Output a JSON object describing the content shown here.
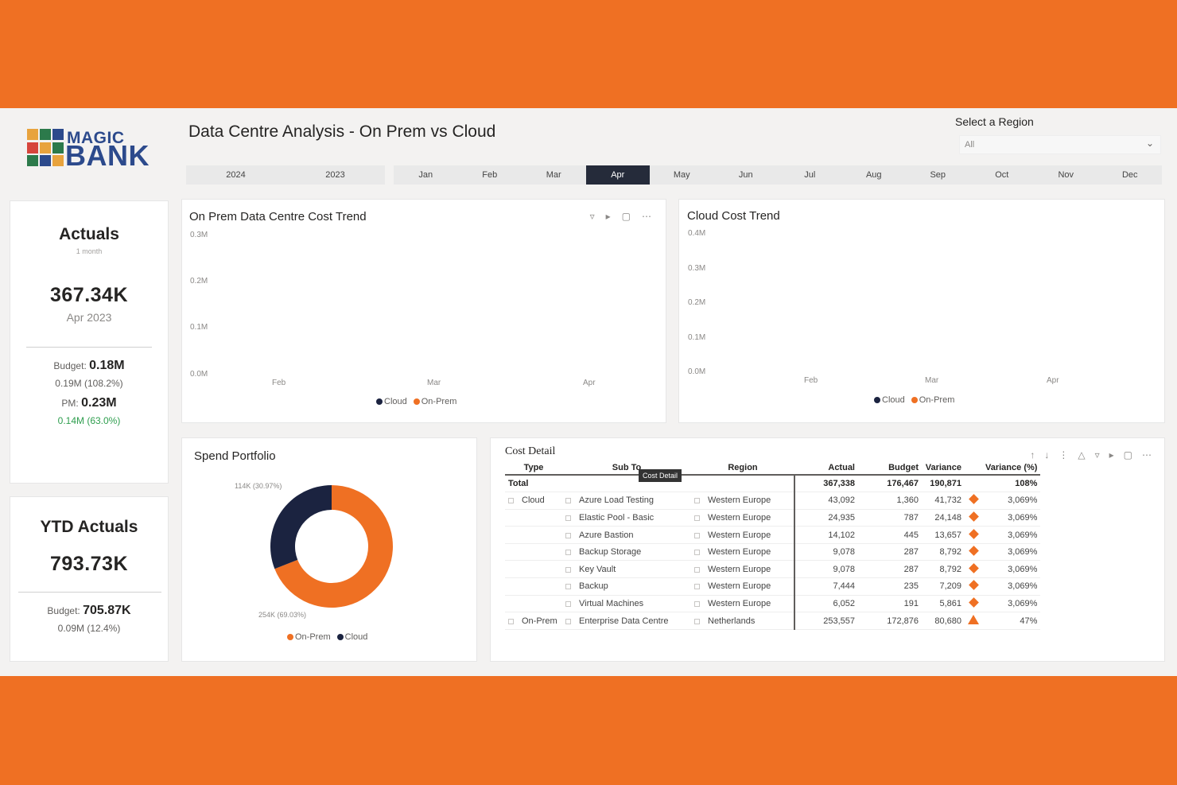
{
  "app": {
    "title": "Data Centre Analysis - On Prem vs Cloud",
    "logo_top": "MAGIC",
    "logo_bottom": "BANK"
  },
  "region": {
    "label": "Select a Region",
    "value": "All"
  },
  "years": [
    "2024",
    "2023"
  ],
  "months": [
    "Jan",
    "Feb",
    "Mar",
    "Apr",
    "May",
    "Jun",
    "Jul",
    "Aug",
    "Sep",
    "Oct",
    "Nov",
    "Dec"
  ],
  "selected_month": "Apr",
  "actuals": {
    "title": "Actuals",
    "subtitle": "1 month",
    "value": "367.34K",
    "period": "Apr 2023",
    "budget_label": "Budget:",
    "budget_value": "0.18M",
    "budget_variance": "0.19M (108.2%)",
    "pm_label": "PM:",
    "pm_value": "0.23M",
    "pm_variance": "0.14M (63.0%)"
  },
  "ytd": {
    "title": "YTD Actuals",
    "value": "793.73K",
    "budget_label": "Budget:",
    "budget_value": "705.87K",
    "budget_variance": "0.09M (12.4%)"
  },
  "onprem_trend": {
    "title": "On Prem Data Centre Cost Trend",
    "y_ticks": [
      "0.3M",
      "0.2M",
      "0.1M",
      "0.0M"
    ],
    "x_ticks": [
      "Feb",
      "Mar",
      "Apr"
    ],
    "legend": [
      {
        "name": "Cloud",
        "color": "#1b2340"
      },
      {
        "name": "On-Prem",
        "color": "#ef7023"
      }
    ]
  },
  "cloud_trend": {
    "title": "Cloud Cost Trend",
    "y_ticks": [
      "0.4M",
      "0.3M",
      "0.2M",
      "0.1M",
      "0.0M"
    ],
    "x_ticks": [
      "Feb",
      "Mar",
      "Apr"
    ],
    "legend": [
      {
        "name": "Cloud",
        "color": "#1b2340"
      },
      {
        "name": "On-Prem",
        "color": "#ef7023"
      }
    ]
  },
  "spend_portfolio": {
    "title": "Spend Portfolio",
    "label_cloud": "114K (30.97%)",
    "label_onprem": "254K (69.03%)",
    "legend": [
      {
        "name": "On-Prem",
        "color": "#ef7023"
      },
      {
        "name": "Cloud",
        "color": "#1b2340"
      }
    ]
  },
  "chart_data": {
    "type": "pie",
    "title": "Spend Portfolio",
    "categories": [
      "On-Prem",
      "Cloud"
    ],
    "values": [
      254,
      114
    ],
    "percents": [
      69.03,
      30.97
    ],
    "colors": [
      "#ef7023",
      "#1b2340"
    ]
  },
  "cost_detail": {
    "title": "Cost Detail",
    "tooltip": "Cost Detail",
    "columns": [
      "Type",
      "Sub To",
      "Region",
      "Actual",
      "Budget",
      "Variance",
      "Variance (%)"
    ],
    "total": {
      "label": "Total",
      "actual": "367,338",
      "budget": "176,467",
      "variance": "190,871",
      "variance_pct": "108%"
    },
    "rows": [
      {
        "type": "Cloud",
        "sub": "Azure Load Testing",
        "region": "Western Europe",
        "actual": "43,092",
        "budget": "1,360",
        "variance": "41,732",
        "marker": "diamond",
        "variance_pct": "3,069%"
      },
      {
        "type": "",
        "sub": "Elastic Pool - Basic",
        "region": "Western Europe",
        "actual": "24,935",
        "budget": "787",
        "variance": "24,148",
        "marker": "diamond",
        "variance_pct": "3,069%"
      },
      {
        "type": "",
        "sub": "Azure Bastion",
        "region": "Western Europe",
        "actual": "14,102",
        "budget": "445",
        "variance": "13,657",
        "marker": "diamond",
        "variance_pct": "3,069%"
      },
      {
        "type": "",
        "sub": "Backup Storage",
        "region": "Western Europe",
        "actual": "9,078",
        "budget": "287",
        "variance": "8,792",
        "marker": "diamond",
        "variance_pct": "3,069%"
      },
      {
        "type": "",
        "sub": "Key Vault",
        "region": "Western Europe",
        "actual": "9,078",
        "budget": "287",
        "variance": "8,792",
        "marker": "diamond",
        "variance_pct": "3,069%"
      },
      {
        "type": "",
        "sub": "Backup",
        "region": "Western Europe",
        "actual": "7,444",
        "budget": "235",
        "variance": "7,209",
        "marker": "diamond",
        "variance_pct": "3,069%"
      },
      {
        "type": "",
        "sub": "Virtual Machines",
        "region": "Western Europe",
        "actual": "6,052",
        "budget": "191",
        "variance": "5,861",
        "marker": "diamond",
        "variance_pct": "3,069%"
      },
      {
        "type": "On-Prem",
        "sub": "Enterprise Data Centre",
        "region": "Netherlands",
        "actual": "253,557",
        "budget": "172,876",
        "variance": "80,680",
        "marker": "triangle",
        "variance_pct": "47%"
      }
    ]
  },
  "colors": {
    "accent": "#ef7023",
    "navy": "#1b2340",
    "selected": "#252b3a",
    "positive": "#2e9e4e"
  }
}
